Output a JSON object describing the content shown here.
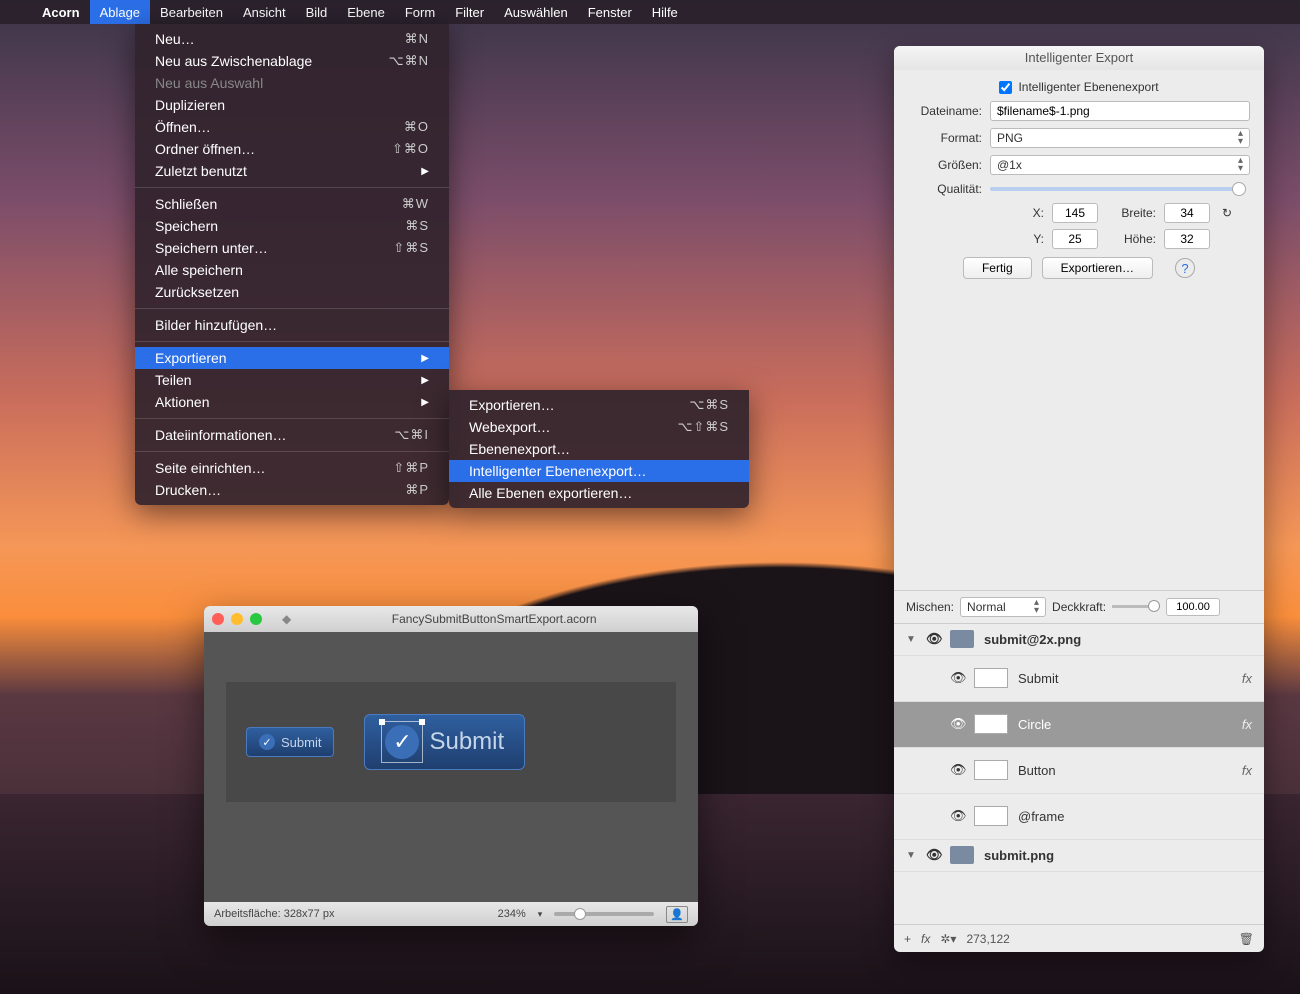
{
  "menubar": {
    "app": "Acorn",
    "items": [
      "Ablage",
      "Bearbeiten",
      "Ansicht",
      "Bild",
      "Ebene",
      "Form",
      "Filter",
      "Auswählen",
      "Fenster",
      "Hilfe"
    ],
    "active": "Ablage"
  },
  "file_menu": {
    "groups": [
      [
        {
          "label": "Neu…",
          "shortcut": "⌘N"
        },
        {
          "label": "Neu aus Zwischenablage",
          "shortcut": "⌥⌘N"
        },
        {
          "label": "Neu aus Auswahl",
          "shortcut": "",
          "disabled": true
        },
        {
          "label": "Duplizieren",
          "shortcut": ""
        },
        {
          "label": "Öffnen…",
          "shortcut": "⌘O"
        },
        {
          "label": "Ordner öffnen…",
          "shortcut": "⇧⌘O"
        },
        {
          "label": "Zuletzt benutzt",
          "shortcut": "▶",
          "submenu": true
        }
      ],
      [
        {
          "label": "Schließen",
          "shortcut": "⌘W"
        },
        {
          "label": "Speichern",
          "shortcut": "⌘S"
        },
        {
          "label": "Speichern unter…",
          "shortcut": "⇧⌘S"
        },
        {
          "label": "Alle speichern",
          "shortcut": ""
        },
        {
          "label": "Zurücksetzen",
          "shortcut": ""
        }
      ],
      [
        {
          "label": "Bilder hinzufügen…",
          "shortcut": ""
        }
      ],
      [
        {
          "label": "Exportieren",
          "shortcut": "▶",
          "submenu": true,
          "selected": true
        },
        {
          "label": "Teilen",
          "shortcut": "▶",
          "submenu": true
        },
        {
          "label": "Aktionen",
          "shortcut": "▶",
          "submenu": true
        }
      ],
      [
        {
          "label": "Dateiinformationen…",
          "shortcut": "⌥⌘I"
        }
      ],
      [
        {
          "label": "Seite einrichten…",
          "shortcut": "⇧⌘P"
        },
        {
          "label": "Drucken…",
          "shortcut": "⌘P"
        }
      ]
    ]
  },
  "export_submenu": [
    {
      "label": "Exportieren…",
      "shortcut": "⌥⌘S"
    },
    {
      "label": "Webexport…",
      "shortcut": "⌥⇧⌘S"
    },
    {
      "label": "Ebenenexport…",
      "shortcut": ""
    },
    {
      "label": "Intelligenter Ebenenexport…",
      "shortcut": "",
      "selected": true
    },
    {
      "label": "Alle Ebenen exportieren…",
      "shortcut": ""
    }
  ],
  "doc": {
    "title": "FancySubmitButtonSmartExport.acorn",
    "btn_small": "Submit",
    "btn_large": "Submit",
    "status_artboard": "Arbeitsfläche: 328x77 px",
    "status_zoom": "234%"
  },
  "panel": {
    "title": "Intelligenter Export",
    "check_label": "Intelligenter Ebenenexport",
    "filename_label": "Dateiname:",
    "filename_value": "$filename$-1.png",
    "format_label": "Format:",
    "format_value": "PNG",
    "sizes_label": "Größen:",
    "sizes_value": "@1x",
    "quality_label": "Qualität:",
    "x_label": "X:",
    "x_value": "145",
    "y_label": "Y:",
    "y_value": "25",
    "width_label": "Breite:",
    "width_value": "34",
    "height_label": "Höhe:",
    "height_value": "32",
    "done_btn": "Fertig",
    "export_btn": "Exportieren…",
    "mix_label": "Mischen:",
    "mix_value": "Normal",
    "opacity_label": "Deckkraft:",
    "opacity_value": "100.00",
    "layers": [
      {
        "type": "group",
        "name": "submit@2x.png"
      },
      {
        "type": "layer",
        "name": "Submit",
        "fx": true
      },
      {
        "type": "layer",
        "name": "Circle",
        "fx": true,
        "selected": true
      },
      {
        "type": "layer",
        "name": "Button",
        "fx": true
      },
      {
        "type": "layer",
        "name": "@frame"
      },
      {
        "type": "group",
        "name": "submit.png"
      }
    ],
    "coords": "273,122"
  }
}
